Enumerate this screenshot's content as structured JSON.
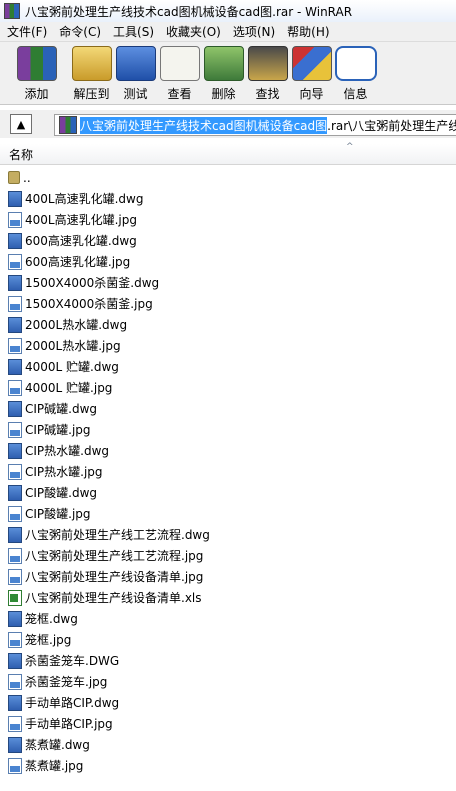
{
  "window": {
    "title": "八宝粥前处理生产线技术cad图机械设备cad图.rar - WinRAR",
    "icon": "winrar-icon"
  },
  "menu": [
    "文件(F)",
    "命令(C)",
    "工具(S)",
    "收藏夹(O)",
    "选项(N)",
    "帮助(H)"
  ],
  "toolbar": [
    {
      "label": "添加",
      "icon": "add-archive-icon"
    },
    {
      "label": "解压到",
      "icon": "extract-to-icon"
    },
    {
      "label": "测试",
      "icon": "test-icon"
    },
    {
      "label": "查看",
      "icon": "view-icon"
    },
    {
      "label": "删除",
      "icon": "delete-icon"
    },
    {
      "label": "查找",
      "icon": "find-icon"
    },
    {
      "label": "向导",
      "icon": "wizard-icon"
    },
    {
      "label": "信息",
      "icon": "info-icon"
    }
  ],
  "address": {
    "selected": "八宝粥前处理生产线技术cad图机械设备cad图",
    "rest": ".rar\\八宝粥前处理生产线"
  },
  "columns": {
    "name": "名称"
  },
  "files": [
    {
      "name": "..",
      "type": "folder"
    },
    {
      "name": "400L高速乳化罐.dwg",
      "type": "dwg"
    },
    {
      "name": "400L高速乳化罐.jpg",
      "type": "jpg"
    },
    {
      "name": "600高速乳化罐.dwg",
      "type": "dwg"
    },
    {
      "name": "600高速乳化罐.jpg",
      "type": "jpg"
    },
    {
      "name": "1500X4000杀菌釜.dwg",
      "type": "dwg"
    },
    {
      "name": "1500X4000杀菌釜.jpg",
      "type": "jpg"
    },
    {
      "name": "2000L热水罐.dwg",
      "type": "dwg"
    },
    {
      "name": "2000L热水罐.jpg",
      "type": "jpg"
    },
    {
      "name": "4000L 贮罐.dwg",
      "type": "dwg"
    },
    {
      "name": "4000L 贮罐.jpg",
      "type": "jpg"
    },
    {
      "name": "CIP碱罐.dwg",
      "type": "dwg"
    },
    {
      "name": "CIP碱罐.jpg",
      "type": "jpg"
    },
    {
      "name": "CIP热水罐.dwg",
      "type": "dwg"
    },
    {
      "name": "CIP热水罐.jpg",
      "type": "jpg"
    },
    {
      "name": "CIP酸罐.dwg",
      "type": "dwg"
    },
    {
      "name": "CIP酸罐.jpg",
      "type": "jpg"
    },
    {
      "name": "八宝粥前处理生产线工艺流程.dwg",
      "type": "dwg"
    },
    {
      "name": "八宝粥前处理生产线工艺流程.jpg",
      "type": "jpg"
    },
    {
      "name": "八宝粥前处理生产线设备清单.jpg",
      "type": "jpg"
    },
    {
      "name": "八宝粥前处理生产线设备清单.xls",
      "type": "xls"
    },
    {
      "name": "笼框.dwg",
      "type": "dwg"
    },
    {
      "name": "笼框.jpg",
      "type": "jpg"
    },
    {
      "name": "杀菌釜笼车.DWG",
      "type": "dwg"
    },
    {
      "name": "杀菌釜笼车.jpg",
      "type": "jpg"
    },
    {
      "name": "手动单路CIP.dwg",
      "type": "dwg"
    },
    {
      "name": "手动单路CIP.jpg",
      "type": "jpg"
    },
    {
      "name": "蒸煮罐.dwg",
      "type": "dwg"
    },
    {
      "name": "蒸煮罐.jpg",
      "type": "jpg"
    }
  ]
}
